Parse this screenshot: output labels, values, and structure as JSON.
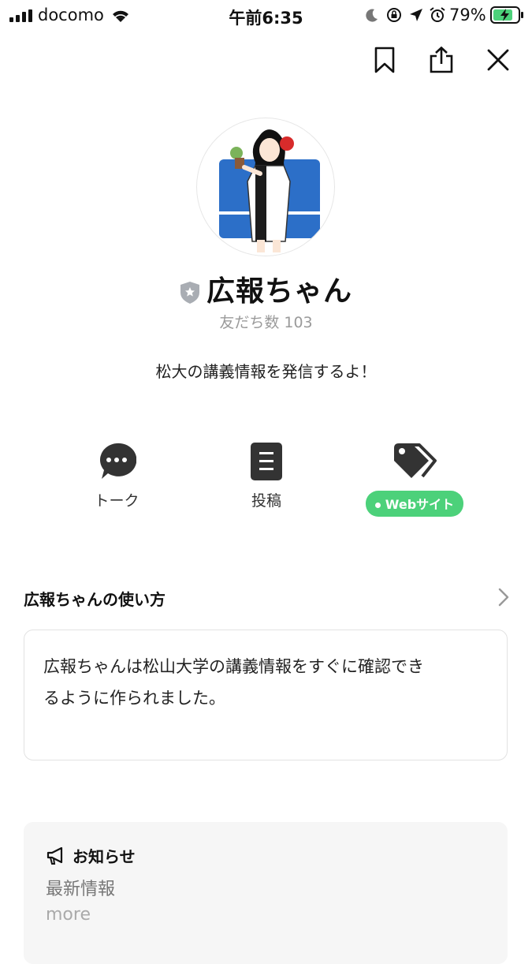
{
  "status_bar": {
    "carrier": "docomo",
    "time": "午前6:35",
    "battery": "79%"
  },
  "profile": {
    "name": "広報ちゃん",
    "friend_count": "友だち数 103",
    "status_message": "松大の講義情報を発信するよ！"
  },
  "actions": {
    "talk_label": "トーク",
    "post_label": "投稿",
    "website_label": "Webサイト"
  },
  "howto": {
    "title": "広報ちゃんの使い方",
    "line1": "広報ちゃんは松山大学の講義情報をすぐに確認でき",
    "line2": "るように作られました。"
  },
  "notice": {
    "title": "お知らせ",
    "subtitle": "最新情報",
    "more": "more"
  },
  "colors": {
    "accent_green": "#4cd17a",
    "icon_dark": "#333333"
  }
}
